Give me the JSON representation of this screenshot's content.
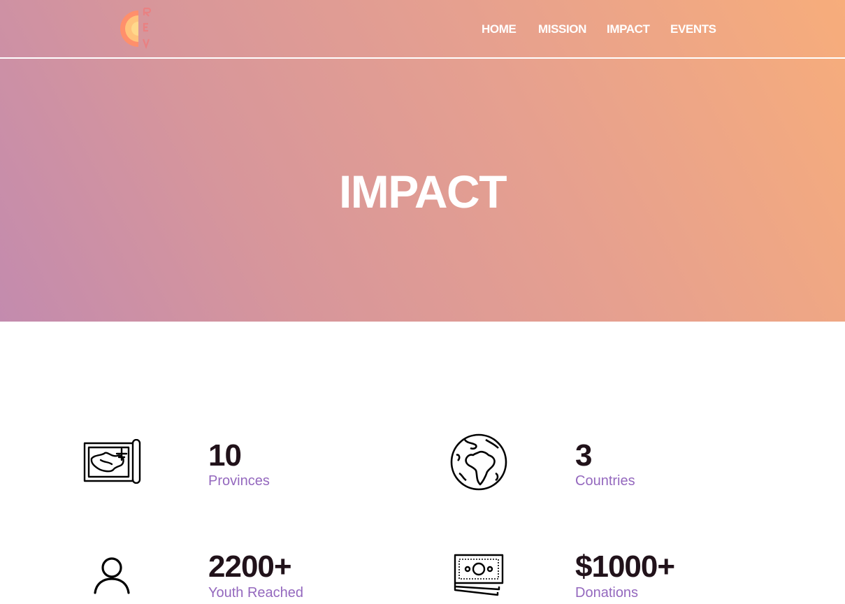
{
  "nav": {
    "links": [
      "HOME",
      "MISSION",
      "IMPACT",
      "EVENTS"
    ]
  },
  "hero": {
    "title": "IMPACT"
  },
  "colors": {
    "gradient_start": "#c38bae",
    "gradient_end": "#f7ad7b",
    "stat_value": "#21121a",
    "stat_label": "#9468be"
  },
  "stats": [
    {
      "icon": "map-icon",
      "value": "10",
      "label": "Provinces"
    },
    {
      "icon": "globe-icon",
      "value": "3",
      "label": "Countries"
    },
    {
      "icon": "person-icon",
      "value": "2200+",
      "label": "Youth Reached"
    },
    {
      "icon": "money-icon",
      "value": "$1000+",
      "label": "Donations"
    }
  ]
}
